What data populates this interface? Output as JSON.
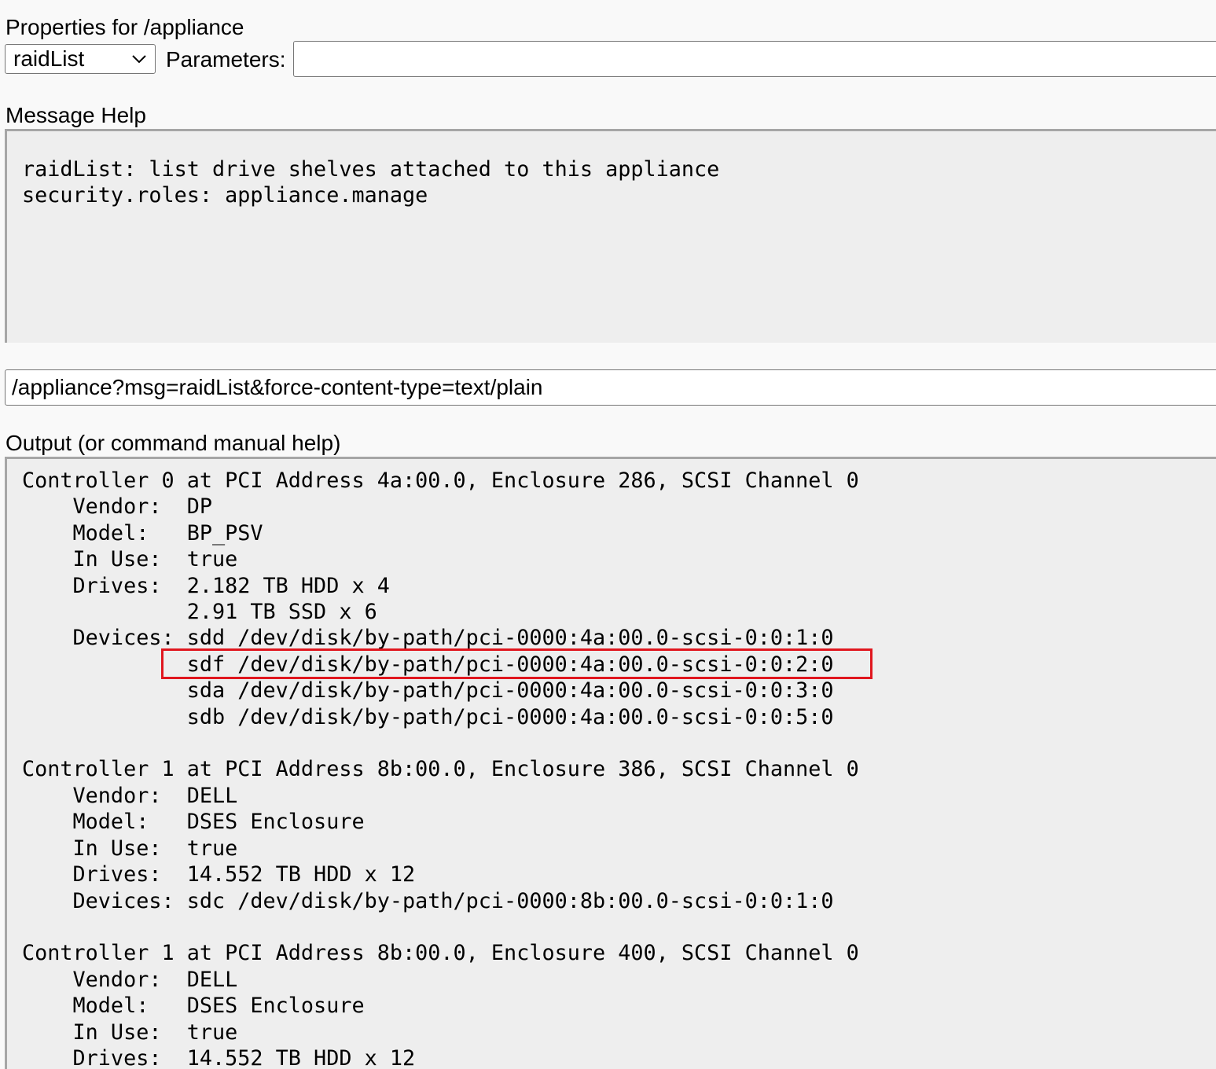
{
  "properties_title": "Properties for /appliance",
  "message_select": {
    "selected": "raidList",
    "chevron_icon": "chevron-down-icon"
  },
  "parameters_label": "Parameters:",
  "parameters_value": "",
  "message_help_title": "Message Help",
  "message_help_text": "raidList: list drive shelves attached to this appliance\nsecurity.roles: appliance.manage",
  "url_value": "/appliance?msg=raidList&force-content-type=text/plain",
  "output_title": "Output (or command manual help)",
  "output_text": "Controller 0 at PCI Address 4a:00.0, Enclosure 286, SCSI Channel 0\n    Vendor:  DP\n    Model:   BP_PSV\n    In Use:  true\n    Drives:  2.182 TB HDD x 4\n             2.91 TB SSD x 6\n    Devices: sdd /dev/disk/by-path/pci-0000:4a:00.0-scsi-0:0:1:0\n             sdf /dev/disk/by-path/pci-0000:4a:00.0-scsi-0:0:2:0\n             sda /dev/disk/by-path/pci-0000:4a:00.0-scsi-0:0:3:0\n             sdb /dev/disk/by-path/pci-0000:4a:00.0-scsi-0:0:5:0\n\nController 1 at PCI Address 8b:00.0, Enclosure 386, SCSI Channel 0\n    Vendor:  DELL\n    Model:   DSES Enclosure\n    In Use:  true\n    Drives:  14.552 TB HDD x 12\n    Devices: sdc /dev/disk/by-path/pci-0000:8b:00.0-scsi-0:0:1:0\n\nController 1 at PCI Address 8b:00.0, Enclosure 400, SCSI Channel 0\n    Vendor:  DELL\n    Model:   DSES Enclosure\n    In Use:  true\n    Drives:  14.552 TB HDD x 12",
  "colors": {
    "highlight": "#e0161e",
    "textarea_bg": "#eeeeee",
    "page_bg": "#f9f9f9"
  }
}
